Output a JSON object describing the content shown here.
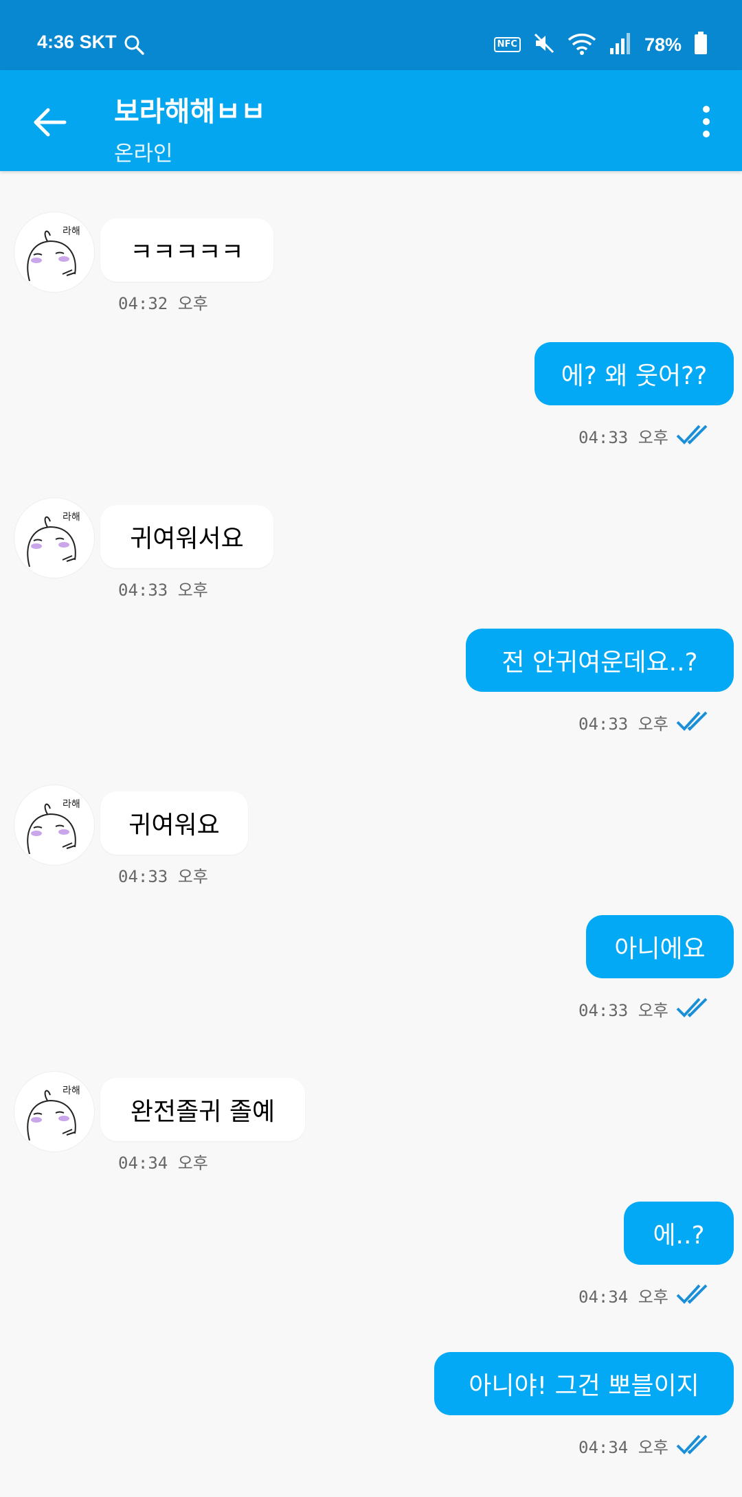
{
  "status_bar": {
    "time": "4:36",
    "carrier": "SKT",
    "nfc": "NFC",
    "battery": "78%"
  },
  "header": {
    "title": "보라해해ㅂㅂ",
    "status": "온라인"
  },
  "messages": [
    {
      "direction": "in",
      "text": "ㅋㅋㅋㅋㅋ",
      "time": "04:32 오후"
    },
    {
      "direction": "out",
      "text": "에? 왜 웃어??",
      "time": "04:33 오후"
    },
    {
      "direction": "in",
      "text": "귀여워서요",
      "time": "04:33 오후"
    },
    {
      "direction": "out",
      "text": "전 안귀여운데요..?",
      "time": "04:33 오후"
    },
    {
      "direction": "in",
      "text": "귀여워요",
      "time": "04:33 오후"
    },
    {
      "direction": "out",
      "text": "아니에요",
      "time": "04:33 오후"
    },
    {
      "direction": "in",
      "text": "완전졸귀 졸예",
      "time": "04:34 오후"
    },
    {
      "direction": "out",
      "text": "에..?",
      "time": "04:34 오후"
    },
    {
      "direction": "out",
      "text": "아니야! 그건 뽀블이지",
      "time": "04:34 오후"
    }
  ],
  "colors": {
    "status_bar": "#0788d0",
    "app_bar": "#04a6f0",
    "outgoing_bubble": "#03a9f4",
    "incoming_bubble": "#ffffff",
    "read_check": "#1a8fd8"
  },
  "icons": {
    "back": "arrow-left-icon",
    "menu": "more-vert-icon",
    "search": "search-icon",
    "read": "double-check-icon"
  }
}
